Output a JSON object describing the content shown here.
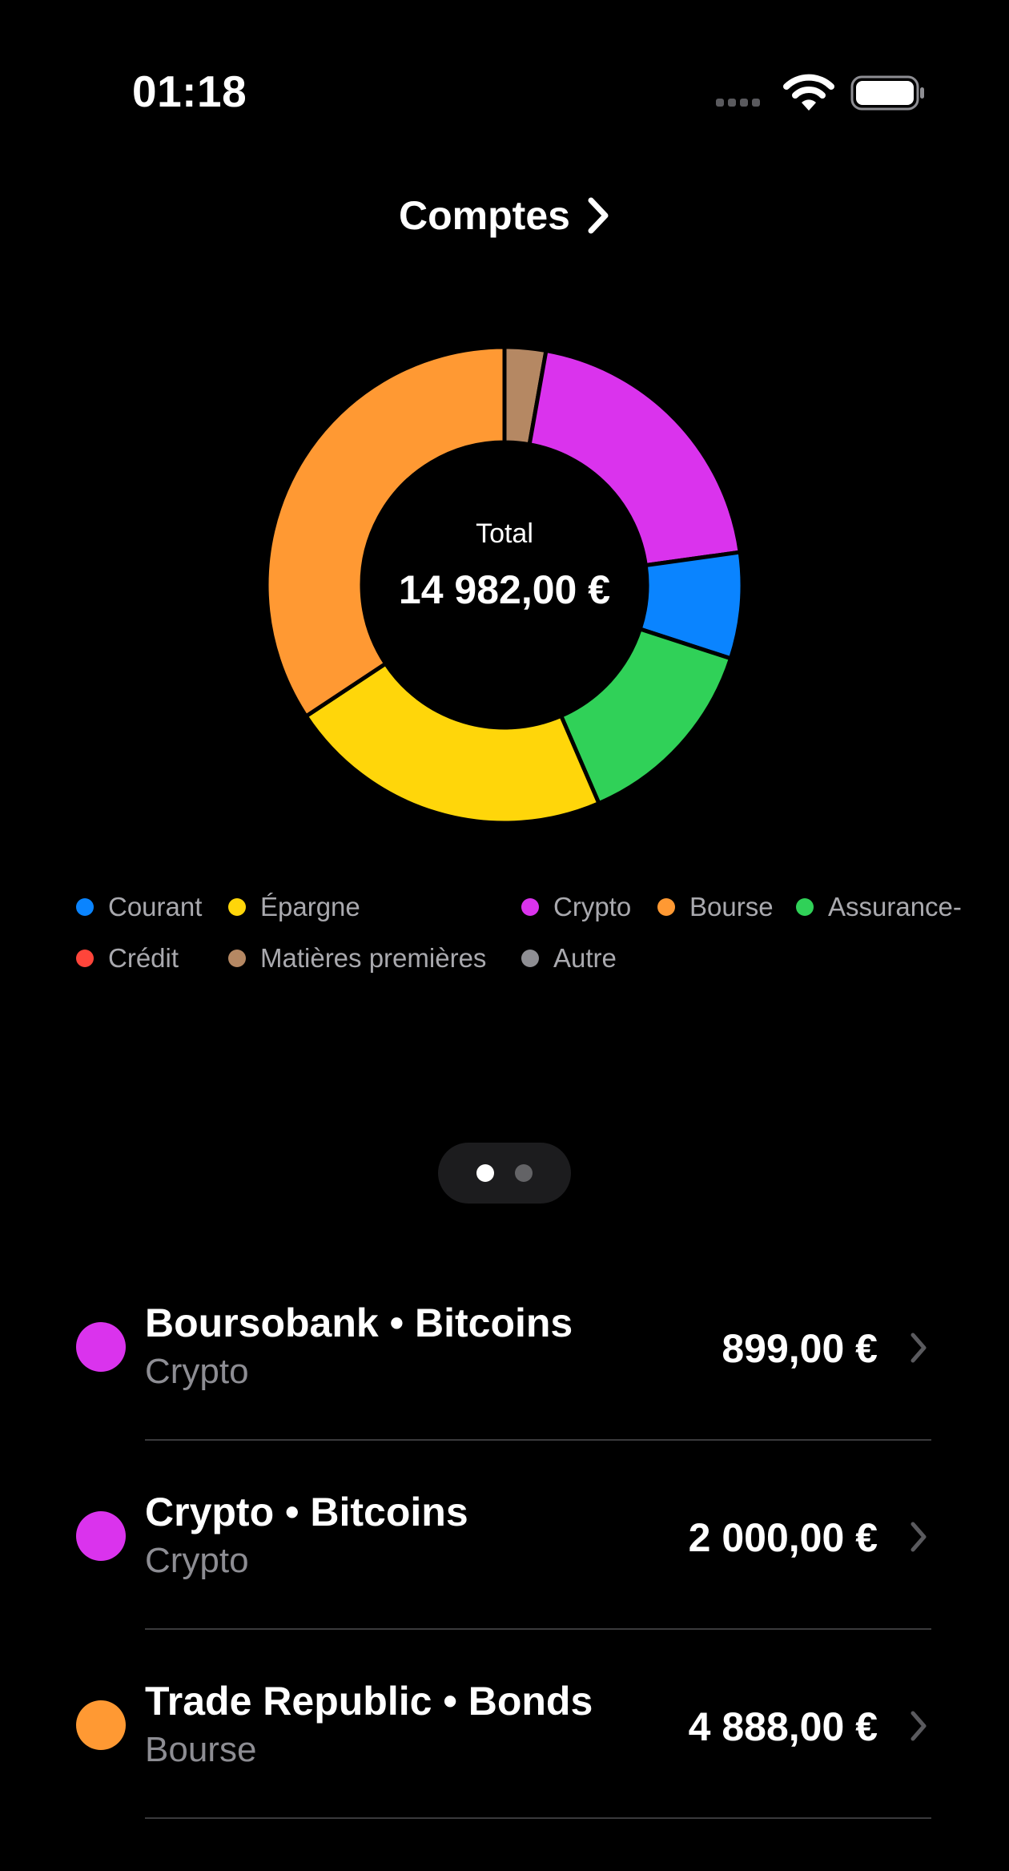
{
  "status_bar": {
    "time": "01:18"
  },
  "header": {
    "title": "Comptes"
  },
  "chart_center": {
    "label": "Total",
    "total": "14 982,00 €"
  },
  "chart_data": {
    "type": "pie",
    "style": "donut",
    "total_label": "Total",
    "total_value": "14 982,00 €",
    "slices": [
      {
        "label": "Matières premières",
        "value": 0.028,
        "color": "#B58863"
      },
      {
        "label": "Crypto",
        "value": 0.2,
        "color": "#DA33ED"
      },
      {
        "label": "Courant",
        "value": 0.072,
        "color": "#0A84FF"
      },
      {
        "label": "Assurance-",
        "value": 0.135,
        "color": "#30D158"
      },
      {
        "label": "Épargne",
        "value": 0.222,
        "color": "#FFD60A"
      },
      {
        "label": "Bourse",
        "value": 0.343,
        "color": "#FF9933"
      }
    ]
  },
  "legend": [
    {
      "label": "Courant",
      "color": "#0A84FF"
    },
    {
      "label": "Épargne",
      "color": "#FFD60A"
    },
    {
      "label": "Crypto",
      "color": "#DA33ED"
    },
    {
      "label": "Bourse",
      "color": "#FF9933"
    },
    {
      "label": "Assurance-",
      "color": "#30D158"
    },
    {
      "label": "Crédit",
      "color": "#FF453A"
    },
    {
      "label": "Matières premières",
      "color": "#B58863"
    },
    {
      "label": "Autre",
      "color": "#8E8E93"
    }
  ],
  "pager": {
    "active_page": 1,
    "page_count": 2
  },
  "accounts": [
    {
      "name": "Boursobank • Bitcoins",
      "type": "Crypto",
      "amount": "899,00 €",
      "color": "#DA33ED"
    },
    {
      "name": "Crypto • Bitcoins",
      "type": "Crypto",
      "amount": "2 000,00 €",
      "color": "#DA33ED"
    },
    {
      "name": "Trade Republic • Bonds",
      "type": "Bourse",
      "amount": "4 888,00 €",
      "color": "#FF9933"
    }
  ]
}
